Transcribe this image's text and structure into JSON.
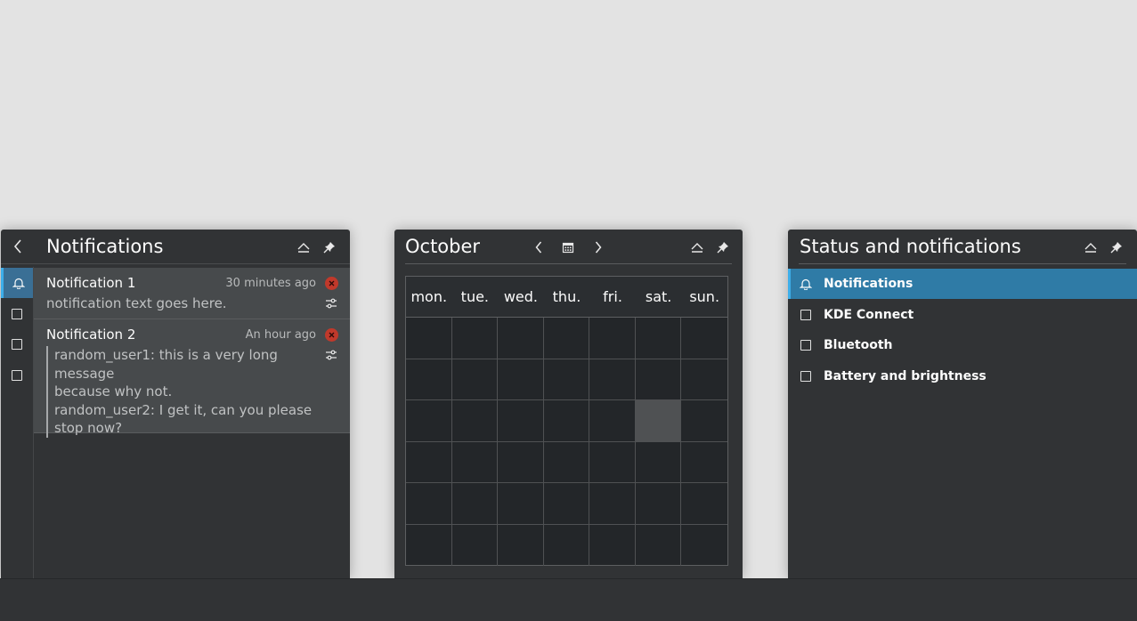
{
  "notifications_panel": {
    "title": "Notifications",
    "sidebar": [
      {
        "icon": "bell-icon"
      },
      {
        "icon": "checkbox-icon"
      },
      {
        "icon": "checkbox-icon"
      },
      {
        "icon": "checkbox-icon"
      }
    ],
    "items": [
      {
        "title": "Notification 1",
        "time": "30 minutes ago",
        "body": "notification text goes here."
      },
      {
        "title": "Notification 2",
        "time": "An hour ago",
        "lines": [
          "random_user1: this is a very long message",
          "because why not.",
          "random_user2: I get it, can you please",
          "stop now?"
        ]
      }
    ]
  },
  "calendar_panel": {
    "month": "October",
    "weekdays": [
      "mon.",
      "tue.",
      "wed.",
      "thu.",
      "fri.",
      "sat.",
      "sun."
    ],
    "rows": 6,
    "highlighted_cell": {
      "row": 2,
      "col": 5
    }
  },
  "status_panel": {
    "title": "Status and notifications",
    "items": [
      {
        "label": "Notifications",
        "icon": "bell-icon",
        "active": true
      },
      {
        "label": "KDE Connect",
        "icon": "checkbox-icon",
        "active": false
      },
      {
        "label": "Bluetooth",
        "icon": "checkbox-icon",
        "active": false
      },
      {
        "label": "Battery and brightness",
        "icon": "checkbox-icon",
        "active": false
      }
    ]
  },
  "colors": {
    "panel_bg": "#313335",
    "accent": "#3daee9",
    "active_row": "#2f7ba6",
    "close_button": "#c0392b",
    "desktop": "#e3e3e3"
  }
}
